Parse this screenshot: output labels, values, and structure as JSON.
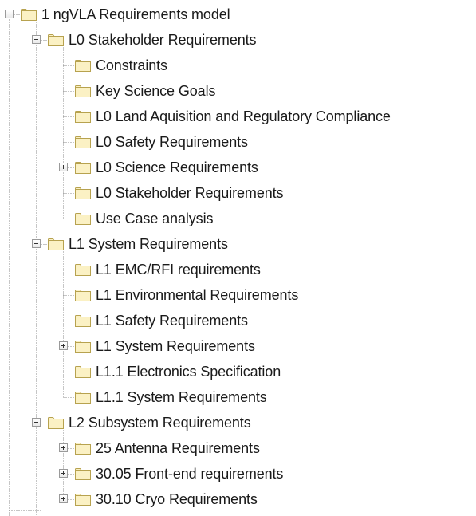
{
  "tree": {
    "root": {
      "label": "1 ngVLA Requirements model",
      "icon": "folder-icon",
      "expanded": true,
      "children": [
        {
          "label": "L0 Stakeholder Requirements",
          "icon": "folder-icon",
          "expanded": true,
          "children": [
            {
              "label": "Constraints",
              "icon": "folder-icon",
              "has_children": false
            },
            {
              "label": "Key Science Goals",
              "icon": "folder-icon",
              "has_children": false
            },
            {
              "label": "L0 Land Aquisition and Regulatory Compliance",
              "icon": "folder-icon",
              "has_children": false
            },
            {
              "label": "L0 Safety Requirements",
              "icon": "folder-icon",
              "has_children": false
            },
            {
              "label": "L0 Science Requirements",
              "icon": "folder-icon",
              "has_children": true,
              "expanded": false
            },
            {
              "label": "L0 Stakeholder Requirements",
              "icon": "folder-icon",
              "has_children": false
            },
            {
              "label": "Use Case analysis",
              "icon": "folder-icon",
              "has_children": false
            }
          ]
        },
        {
          "label": "L1 System Requirements",
          "icon": "folder-icon",
          "expanded": true,
          "children": [
            {
              "label": "L1 EMC/RFI requirements",
              "icon": "folder-icon",
              "has_children": false
            },
            {
              "label": "L1 Environmental Requirements",
              "icon": "folder-icon",
              "has_children": false
            },
            {
              "label": "L1 Safety Requirements",
              "icon": "folder-icon",
              "has_children": false
            },
            {
              "label": "L1 System Requirements",
              "icon": "folder-icon",
              "has_children": true,
              "expanded": false
            },
            {
              "label": "L1.1 Electronics Specification",
              "icon": "folder-icon",
              "has_children": false
            },
            {
              "label": "L1.1 System Requirements",
              "icon": "folder-icon",
              "has_children": false
            }
          ]
        },
        {
          "label": "L2 Subsystem Requirements",
          "icon": "folder-icon",
          "expanded": true,
          "children": [
            {
              "label": "25 Antenna Requirements",
              "icon": "folder-icon",
              "has_children": true,
              "expanded": false
            },
            {
              "label": "30.05 Front-end requirements",
              "icon": "folder-icon",
              "has_children": true,
              "expanded": false
            },
            {
              "label": "30.10 Cryo Requirements",
              "icon": "folder-icon",
              "has_children": true,
              "expanded": false
            }
          ]
        }
      ]
    }
  },
  "colors": {
    "folder_fill": "#fbf1c4",
    "folder_stroke": "#b7a24f",
    "connector": "#8c8c8c",
    "text": "#1a1a1a",
    "background": "#ffffff"
  }
}
